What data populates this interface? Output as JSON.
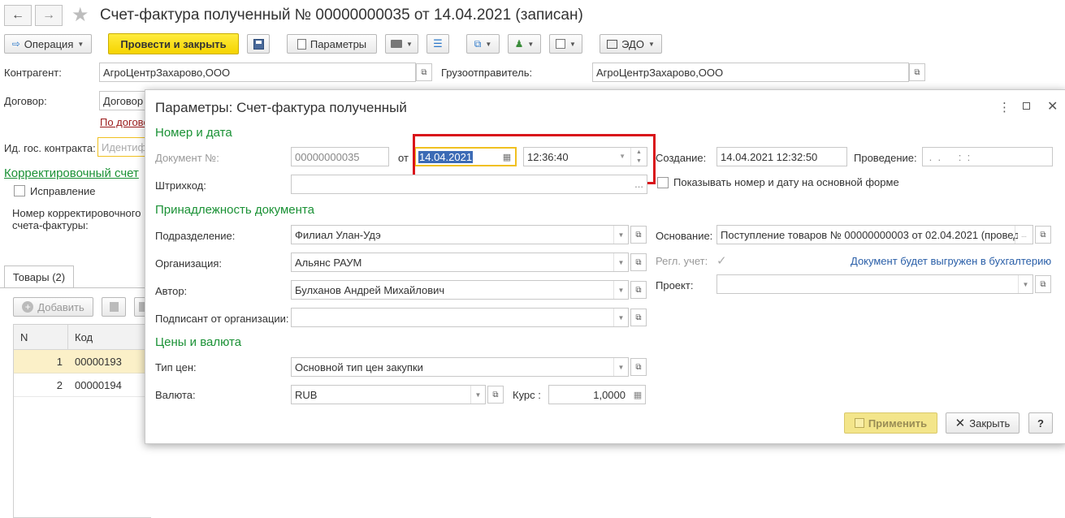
{
  "window": {
    "title": "Счет-фактура полученный № 00000000035 от 14.04.2021 (записан)"
  },
  "toolbar": {
    "operation_label": "Операция",
    "post_close_label": "Провести и закрыть",
    "params_label": "Параметры",
    "edo_label": "ЭДО"
  },
  "form": {
    "contractor_label": "Контрагент:",
    "contractor_value": "АгроЦентрЗахарово,ООО",
    "shipper_label": "Грузоотправитель:",
    "shipper_value": "АгроЦентрЗахарово,ООО",
    "contract_label": "Договор:",
    "contract_value": "Договор",
    "contract_link": "По догово",
    "gov_contract_label": "Ид. гос. контракта:",
    "gov_contract_placeholder": "Идентиф",
    "correction_link": "Корректировочный счет",
    "correction_check_label": "Исправление",
    "correction_number_label": "Номер корректировочного счета-фактуры:"
  },
  "goods": {
    "tab_label": "Товары (2)",
    "add_label": "Добавить",
    "columns": [
      "N",
      "Код"
    ],
    "rows": [
      {
        "n": "1",
        "code": "00000193"
      },
      {
        "n": "2",
        "code": "00000194"
      }
    ]
  },
  "dialog": {
    "title": "Параметры: Счет-фактура полученный",
    "section_number_date": "Номер и дата",
    "doc_number_label": "Документ №:",
    "doc_number_value": "00000000035",
    "from_label": "от",
    "date_value": "14.04.2021",
    "time_value": "12:36:40",
    "created_label": "Создание:",
    "created_value": "14.04.2021 12:32:50",
    "posting_label": "Проведение:",
    "posting_value": " .  .      :  :",
    "barcode_label": "Штрихкод:",
    "show_number_label": "Показывать номер и дату на основной форме",
    "section_belonging": "Принадлежность документа",
    "division_label": "Подразделение:",
    "division_value": "Филиал Улан-Удэ",
    "org_label": "Организация:",
    "org_value": "Альянс РАУМ",
    "author_label": "Автор:",
    "author_value": "Булханов Андрей Михайлович",
    "signer_label": "Подписант от организации:",
    "signer_value": "",
    "basis_label": "Основание:",
    "basis_value": "Поступление товаров № 00000000003 от 02.04.2021 (проведе",
    "reg_label": "Регл. учет:",
    "export_link": "Документ будет выгружен в бухгалтерию",
    "project_label": "Проект:",
    "project_value": "",
    "section_prices": "Цены и валюта",
    "price_type_label": "Тип цен:",
    "price_type_value": "Основной тип цен закупки",
    "currency_label": "Валюта:",
    "currency_value": "RUB",
    "rate_label": "Курс :",
    "rate_value": "1,0000",
    "apply_label": "Применить",
    "close_label": "Закрыть",
    "help_label": "?"
  },
  "colors": {
    "section_green": "#1a9135",
    "link_blue": "#2a5fa8",
    "highlight_red": "#d9141a",
    "focus_yellow": "#f0c020",
    "selected_row": "#fbf0c8"
  }
}
